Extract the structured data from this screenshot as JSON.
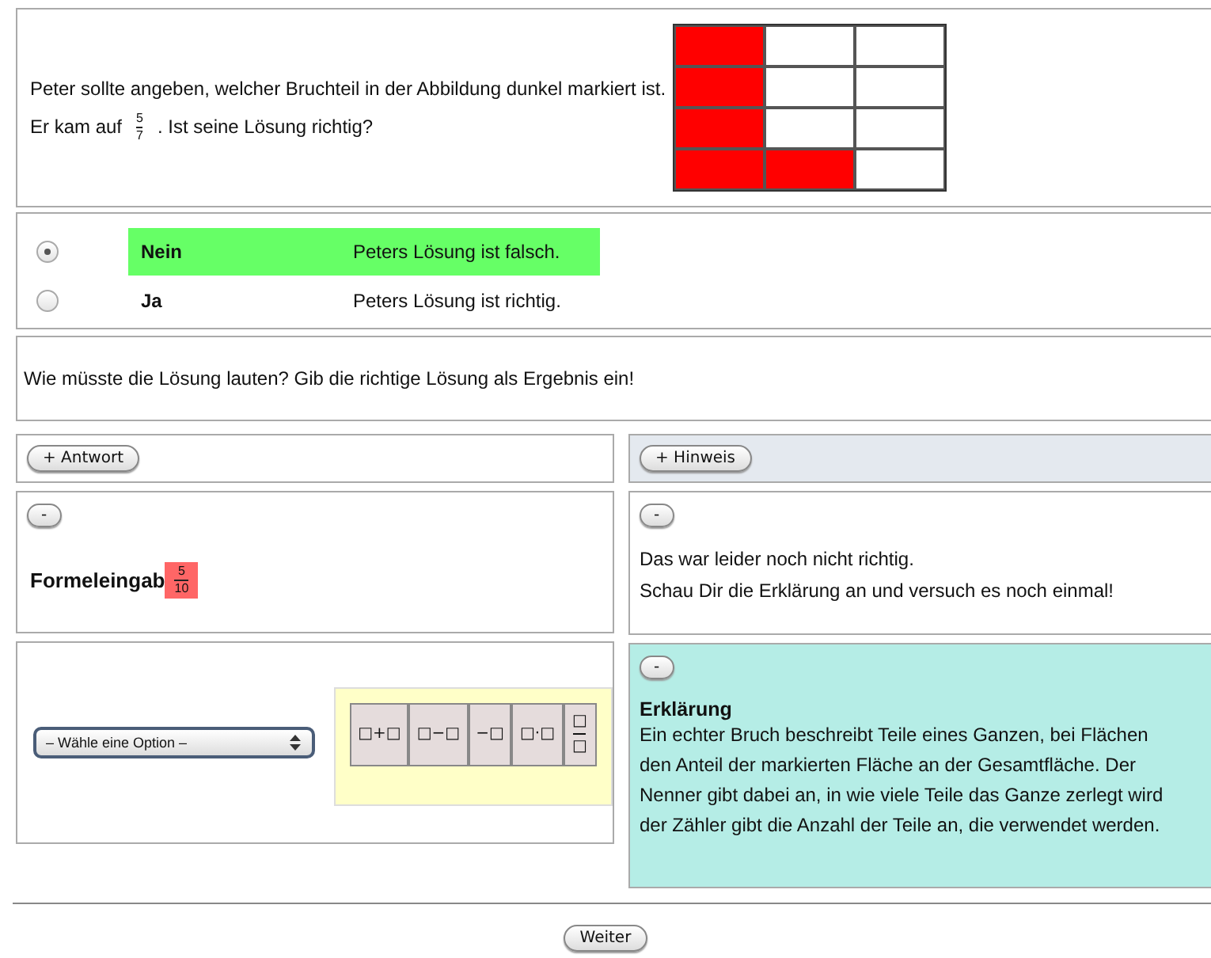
{
  "question": {
    "line1": "Peter sollte angeben, welcher Bruchteil in der Abbildung dunkel markiert ist.",
    "line2_before": "Er kam auf",
    "fraction": {
      "numerator": "5",
      "denominator": "7"
    },
    "line2_after": ". Ist seine Lösung richtig?",
    "grid": [
      [
        {
          "filled": true
        },
        {
          "filled": false
        },
        {
          "filled": false
        }
      ],
      [
        {
          "filled": true
        },
        {
          "filled": false
        },
        {
          "filled": false
        }
      ],
      [
        {
          "filled": true
        },
        {
          "filled": false
        },
        {
          "filled": false
        }
      ],
      [
        {
          "filled": true
        },
        {
          "filled": true
        },
        {
          "filled": false
        }
      ]
    ]
  },
  "choices": [
    {
      "label": "Nein",
      "text": "Peters Lösung ist falsch.",
      "selected": true
    },
    {
      "label": "Ja",
      "text": "Peters Lösung ist richtig.",
      "selected": false
    }
  ],
  "prompt": "Wie müsste die Lösung lauten? Gib die richtige Lösung als Ergebnis ein!",
  "answer_button": "+ Antwort",
  "hint_button": "+ Hinweis",
  "collapse_buttons": [
    "-",
    "-",
    "-"
  ],
  "formula": {
    "label": "Formeleingab",
    "numerator": "5",
    "denominator": "10",
    "wrong": true
  },
  "select": {
    "value": "– Wähle eine Option –"
  },
  "palette": [
    {
      "kind": "text",
      "text": "□+□"
    },
    {
      "kind": "text",
      "text": "□−□"
    },
    {
      "kind": "text",
      "text": "−□"
    },
    {
      "kind": "text",
      "text": "□·□"
    },
    {
      "kind": "fraction",
      "numerator": "□",
      "denominator": "□"
    }
  ],
  "feedback": [
    "Das war leider noch nicht richtig.",
    "Schau Dir die Erklärung an und versuch es noch einmal!"
  ],
  "explanation": {
    "title": "Erklärung",
    "lines": [
      "Ein echter Bruch beschreibt Teile eines Ganzen, bei Flächen",
      "den Anteil der markierten Fläche an der Gesamtfläche. Der",
      "Nenner gibt dabei an, in wie viele Teile das Ganze zerlegt wird",
      "der Zähler gibt die Anzahl der Teile an, die verwendet werden."
    ]
  },
  "next_button": "Weiter"
}
